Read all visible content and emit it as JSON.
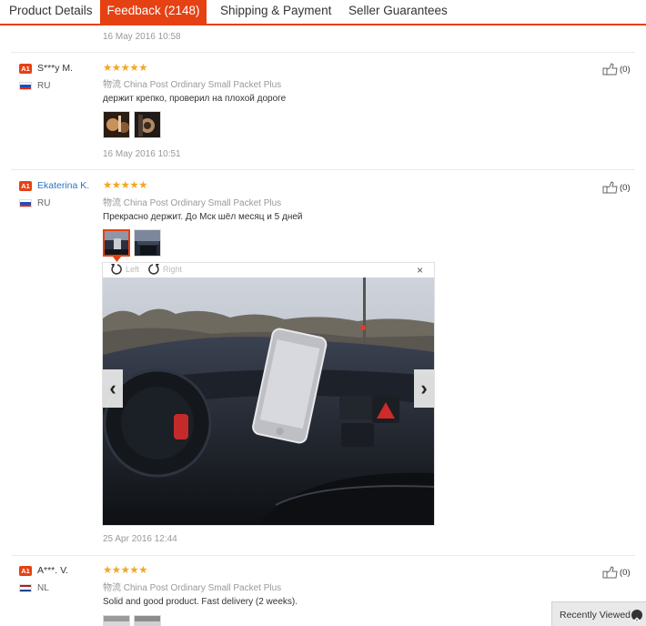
{
  "tabs": [
    {
      "label": "Product Details"
    },
    {
      "label": "Feedback (2148)"
    },
    {
      "label": "Shipping & Payment"
    },
    {
      "label": "Seller Guarantees"
    }
  ],
  "prev_review_date": "16 May 2016 10:58",
  "reviews": [
    {
      "badge": "A1",
      "name": "S***y M.",
      "country": "RU",
      "stars": "★★★★★",
      "rating": 5,
      "shipping": "物流 China Post Ordinary Small Packet Plus",
      "text": "держит крепко, проверил на плохой дороге",
      "date": "16 May 2016 10:51",
      "likes": "(0)"
    },
    {
      "badge": "A1",
      "name": "Ekaterina K.",
      "country": "RU",
      "stars": "★★★★★",
      "rating": 5,
      "shipping": "物流 China Post Ordinary Small Packet Plus",
      "text": "Прекрасно держит. До Мск шёл месяц и 5 дней",
      "date": "25 Apr 2016 12:44",
      "likes": "(0)"
    },
    {
      "badge": "A1",
      "name": "A***. V.",
      "country": "NL",
      "stars": "★★★★★",
      "rating": 5,
      "shipping": "物流 China Post Ordinary Small Packet Plus",
      "text": "Solid and good product. Fast delivery (2 weeks).",
      "likes": "(0)"
    }
  ],
  "viewer": {
    "rotate_left": "Left",
    "rotate_right": "Right",
    "close": "×",
    "prev": "‹",
    "next": "›"
  },
  "recently_viewed": "Recently Viewed",
  "colors": {
    "accent": "#e64113",
    "star": "#f5a623",
    "link": "#2a73c6"
  }
}
